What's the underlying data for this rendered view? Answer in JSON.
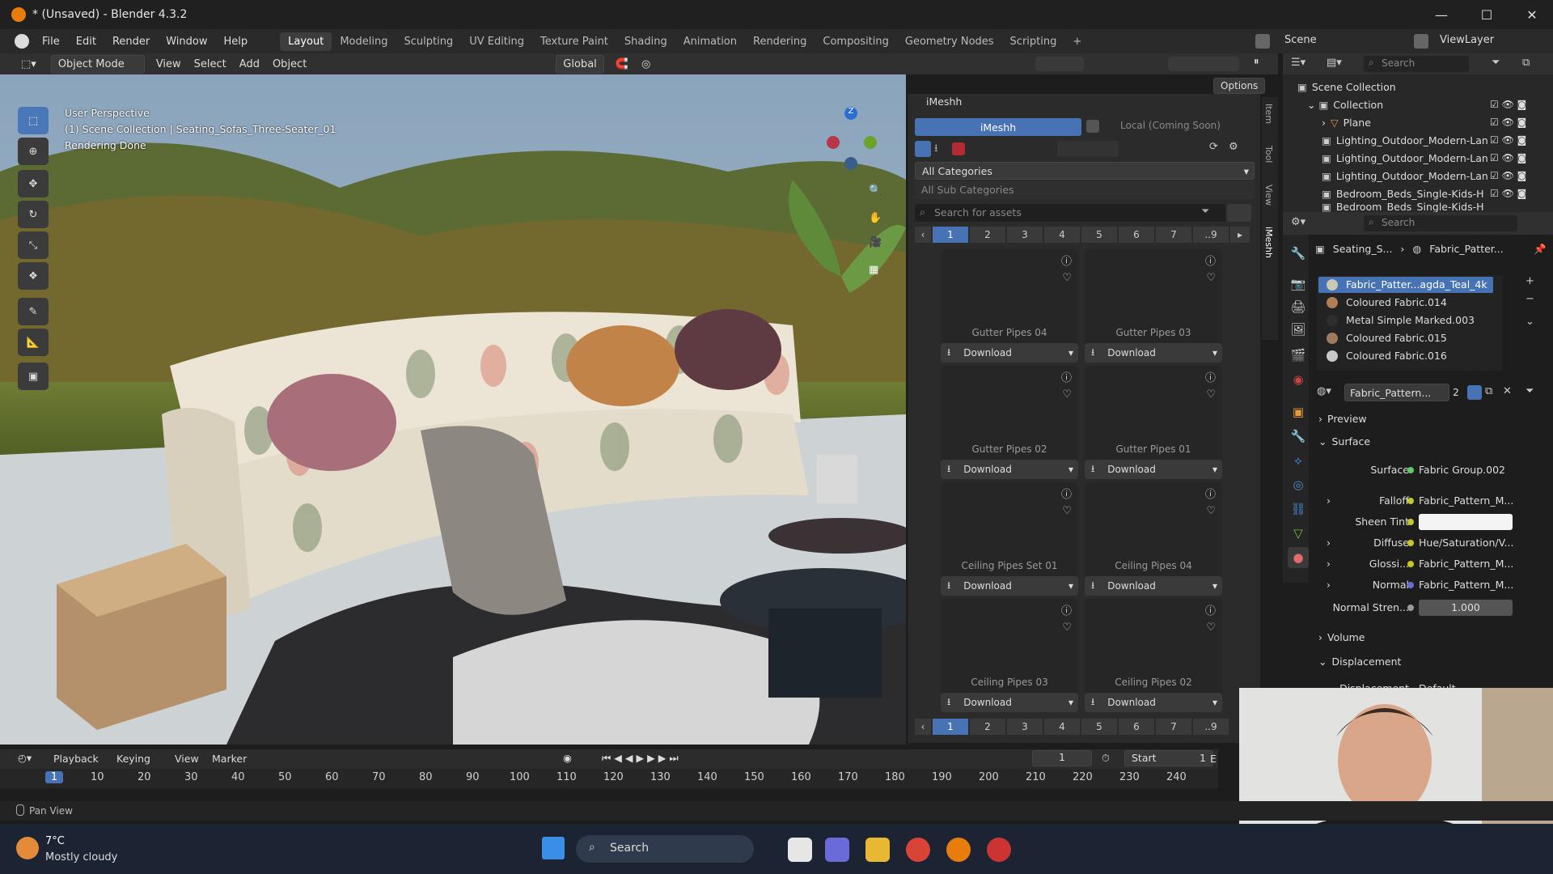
{
  "window": {
    "title": "* (Unsaved) - Blender 4.3.2"
  },
  "menubar": {
    "items": [
      "File",
      "Edit",
      "Render",
      "Window",
      "Help"
    ],
    "workspaces": [
      "Layout",
      "Modeling",
      "Sculpting",
      "UV Editing",
      "Texture Paint",
      "Shading",
      "Animation",
      "Rendering",
      "Compositing",
      "Geometry Nodes",
      "Scripting"
    ],
    "scene_label": "Scene",
    "viewlayer_label": "ViewLayer"
  },
  "viewport_header": {
    "mode": "Object Mode",
    "menus": [
      "View",
      "Select",
      "Add",
      "Object"
    ],
    "transform": "Global",
    "options": "Options"
  },
  "viewport": {
    "line1": "User Perspective",
    "line2": "(1) Scene Collection | Seating_Sofas_Three-Seater_01",
    "line3": "Rendering Done",
    "gizmo_z": "Z"
  },
  "side_tabs": [
    "Item",
    "Tool",
    "View",
    "iMeshh"
  ],
  "imeshh": {
    "panel_title": "iMeshh",
    "tab_active": "iMeshh",
    "tab_local": "Local (Coming Soon)",
    "category": "All Categories",
    "subcategory": "All Sub Categories",
    "search_placeholder": "Search for assets",
    "pages": [
      "1",
      "2",
      "3",
      "4",
      "5",
      "6",
      "7",
      "..9"
    ],
    "download_label": "Download",
    "assets": [
      "Gutter Pipes 04",
      "Gutter Pipes 03",
      "Gutter Pipes 02",
      "Gutter Pipes 01",
      "Ceiling Pipes Set 01",
      "Ceiling Pipes 04",
      "Ceiling Pipes 03",
      "Ceiling Pipes 02"
    ]
  },
  "outliner": {
    "search_placeholder": "Search",
    "root": "Scene Collection",
    "collection": "Collection",
    "items": [
      "Plane",
      "Lighting_Outdoor_Modern-Lan",
      "Lighting_Outdoor_Modern-Lan",
      "Lighting_Outdoor_Modern-Lan",
      "Bedroom_Beds_Single-Kids-H",
      "Bedroom_Beds_Single-Kids-H"
    ]
  },
  "properties": {
    "search_placeholder": "Search",
    "breadcrumb_obj": "Seating_S...",
    "breadcrumb_mat": "Fabric_Patter...",
    "materials": [
      "Fabric_Patter...agda_Teal_4k",
      "Coloured Fabric.014",
      "Metal Simple Marked.003",
      "Coloured Fabric.015",
      "Coloured Fabric.016"
    ],
    "material_name": "Fabric_Pattern...",
    "users": "2",
    "sections": {
      "preview": "Preview",
      "surface": "Surface",
      "volume": "Volume",
      "displacement": "Displacement"
    },
    "rows": [
      {
        "label": "Surface",
        "value": "Fabric Group.002"
      },
      {
        "label": "Falloff",
        "value": "Fabric_Pattern_M..."
      },
      {
        "label": "Sheen Tint",
        "value": ""
      },
      {
        "label": "Diffuse",
        "value": "Hue/Saturation/V..."
      },
      {
        "label": "Glossi...",
        "value": "Fabric_Pattern_M..."
      },
      {
        "label": "Normal",
        "value": "Fabric_Pattern_M..."
      },
      {
        "label": "Normal Stren...",
        "value": "1.000"
      },
      {
        "label": "Displacement",
        "value": "Default"
      }
    ]
  },
  "timeline": {
    "menus": [
      "Playback",
      "Keying",
      "View",
      "Marker"
    ],
    "current_frame": "1",
    "start_label": "Start",
    "start_value": "1",
    "end_label": "E",
    "ticks": [
      "1",
      "10",
      "20",
      "30",
      "40",
      "50",
      "60",
      "70",
      "80",
      "90",
      "100",
      "110",
      "120",
      "130",
      "140",
      "150",
      "160",
      "170",
      "180",
      "190",
      "200",
      "210",
      "220",
      "230",
      "240"
    ]
  },
  "status": {
    "text": "Pan View"
  },
  "taskbar": {
    "temp": "7°C",
    "weather": "Mostly cloudy",
    "search": "Search"
  },
  "colors": {
    "accent": "#4772b3",
    "bg": "#1d1d1d",
    "panel": "#2b2b2b"
  }
}
